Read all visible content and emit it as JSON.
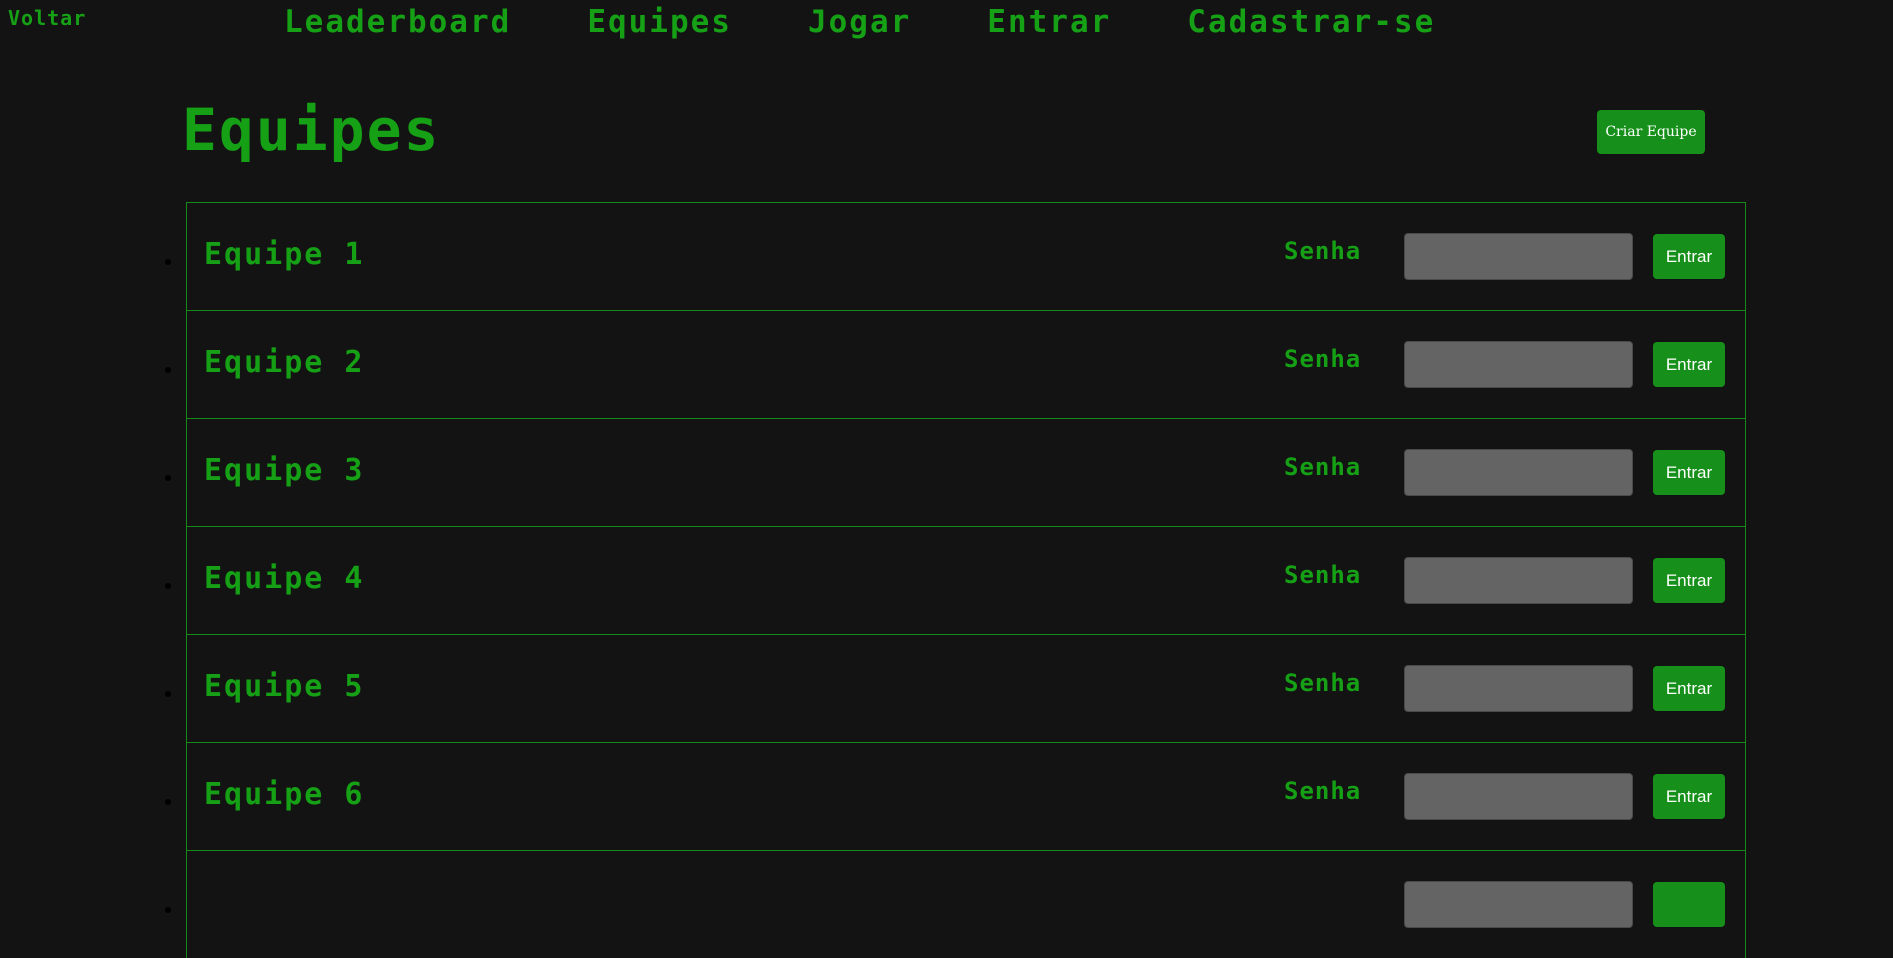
{
  "back_link": "Voltar",
  "nav": {
    "items": [
      "Leaderboard",
      "Equipes",
      "Jogar",
      "Entrar",
      "Cadastrar-se"
    ]
  },
  "page": {
    "title": "Equipes",
    "create_button": "Criar Equipe"
  },
  "teams": [
    {
      "name": "Equipe 1",
      "password_label": "Senha",
      "password_value": "",
      "join_label": "Entrar"
    },
    {
      "name": "Equipe 2",
      "password_label": "Senha",
      "password_value": "",
      "join_label": "Entrar"
    },
    {
      "name": "Equipe 3",
      "password_label": "Senha",
      "password_value": "",
      "join_label": "Entrar"
    },
    {
      "name": "Equipe 4",
      "password_label": "Senha",
      "password_value": "",
      "join_label": "Entrar"
    },
    {
      "name": "Equipe 5",
      "password_label": "Senha",
      "password_value": "",
      "join_label": "Entrar"
    },
    {
      "name": "Equipe 6",
      "password_label": "Senha",
      "password_value": "",
      "join_label": "Entrar"
    },
    {
      "name": "",
      "password_label": "",
      "password_value": "",
      "join_label": ""
    }
  ],
  "colors": {
    "background": "#131313",
    "accent_green": "#16a016",
    "button_green": "#16901a",
    "input_gray": "#646464"
  }
}
